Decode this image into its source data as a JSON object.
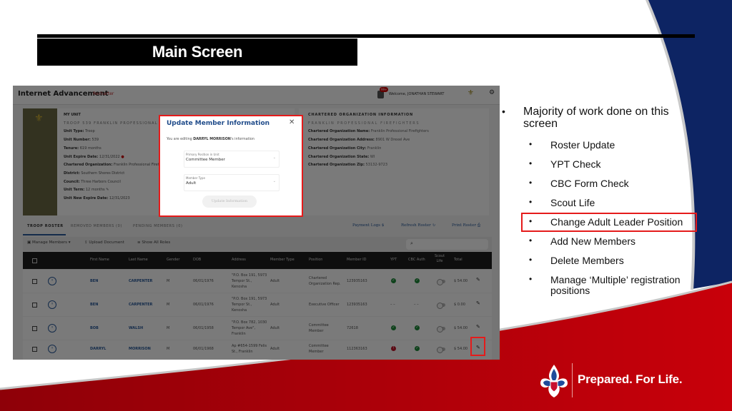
{
  "slide": {
    "title": "Main Screen",
    "bullets": {
      "main": "Majority of work done on this screen",
      "sub": [
        "Roster Update",
        "YPT Check",
        "CBC Form Check",
        "Scout Life",
        "Change Adult Leader Position",
        "Add New Members",
        "Delete Members",
        "Manage ‘Multiple’ registration positions"
      ],
      "highlighted_index": 4
    },
    "footer": {
      "tagline": "Prepared. For Life."
    },
    "colors": {
      "navy": "#0d2463",
      "red": "#c8000a",
      "highlight": "#e51b1b"
    }
  },
  "app": {
    "title": "Internet Advancement",
    "subtitle_link": "Recharter",
    "notification_count": "99+",
    "welcome": "Welcome, JONATHAN STEWART",
    "unit": {
      "header": "MY UNIT",
      "name": "TROOP 539 FRANKLIN PROFESSIONAL FIREFIGHTERS",
      "fields": [
        {
          "label": "Unit Type:",
          "value": "Troop"
        },
        {
          "label": "Unit Number:",
          "value": "539"
        },
        {
          "label": "Tenure:",
          "value": "619 months"
        },
        {
          "label": "Unit Expire Date:",
          "value": "12/31/2022"
        },
        {
          "label": "Chartered Organization:",
          "value": "Franklin Professional Firefighters"
        },
        {
          "label": "District:",
          "value": "Southern Shores District"
        },
        {
          "label": "Council:",
          "value": "Three Harbors Council"
        },
        {
          "label": "Unit Term:",
          "value": "12 months"
        },
        {
          "label": "Unit New Expire Date:",
          "value": "12/31/2023"
        }
      ]
    },
    "org": {
      "header": "CHARTERED ORGANIZATION INFORMATION",
      "name": "FRANKLIN PROFESSIONAL FIREFIGHTERS",
      "fields": [
        {
          "label": "Chartered Organization Name:",
          "value": "Franklin Professional Firefighters"
        },
        {
          "label": "Chartered Organization Address:",
          "value": "8901 W Drexel Ave"
        },
        {
          "label": "Chartered Organization City:",
          "value": "Franklin"
        },
        {
          "label": "Chartered Organization State:",
          "value": "WI"
        },
        {
          "label": "Chartered Organization Zip:",
          "value": "53132-9723"
        }
      ]
    },
    "tabs": [
      "TROOP ROSTER",
      "REMOVED MEMBERS (0)",
      "PENDING MEMBERS (0)"
    ],
    "actions": [
      "Payment Logs",
      "Refresh Roster",
      "Print Roster"
    ],
    "toolbar": {
      "manage_members": "Manage Members",
      "upload_document": "Upload Document",
      "show_all_roles": "Show All Roles",
      "search_placeholder": "Search"
    },
    "table": {
      "columns": [
        "First Name",
        "Last Name",
        "Gender",
        "DOB",
        "Address",
        "Member Type",
        "Position",
        "Member ID",
        "YPT",
        "CBC Auth",
        "Scout Life",
        "Total"
      ],
      "rows": [
        {
          "first": "BEN",
          "last": "CARPENTER",
          "gender": "M",
          "dob": "06/01/1976",
          "address": "\"P.O. Box 191, 5973 Tempor St., Kenosha",
          "type": "Adult",
          "position": "Chartered Organization Rep.",
          "id": "123935163",
          "ypt": "ok",
          "cbc": "ok",
          "total": "$ 54.00"
        },
        {
          "first": "BEN",
          "last": "CARPENTER",
          "gender": "M",
          "dob": "06/01/1976",
          "address": "\"P.O. Box 191, 5973 Tempor St., Kenosha",
          "type": "Adult",
          "position": "Executive Officer",
          "id": "123935163",
          "ypt": "--",
          "cbc": "--",
          "total": "$ 0.00"
        },
        {
          "first": "BOB",
          "last": "WALSH",
          "gender": "M",
          "dob": "06/01/1958",
          "address": "\"P.O. Box 782, 1030 Tempor Ave\", Franklin",
          "type": "Adult",
          "position": "Committee Member",
          "id": "72618",
          "ypt": "ok",
          "cbc": "ok",
          "total": "$ 54.00"
        },
        {
          "first": "DARRYL",
          "last": "MORRISON",
          "gender": "M",
          "dob": "06/01/1968",
          "address": "Ap #654-1599 Felis St., Franklin",
          "type": "Adult",
          "position": "Committee Member",
          "id": "112363163",
          "ypt": "error",
          "cbc": "ok",
          "total": "$ 54.00"
        }
      ]
    },
    "modal": {
      "title": "Update Member Information",
      "editing_prefix": "You are editing ",
      "editing_name": "DARRYL MORRISON",
      "editing_suffix": "'s information",
      "position_label": "Primary Position in Unit",
      "position_value": "Committee Member",
      "type_label": "Member Type",
      "type_value": "Adult",
      "button": "Update Information"
    }
  }
}
